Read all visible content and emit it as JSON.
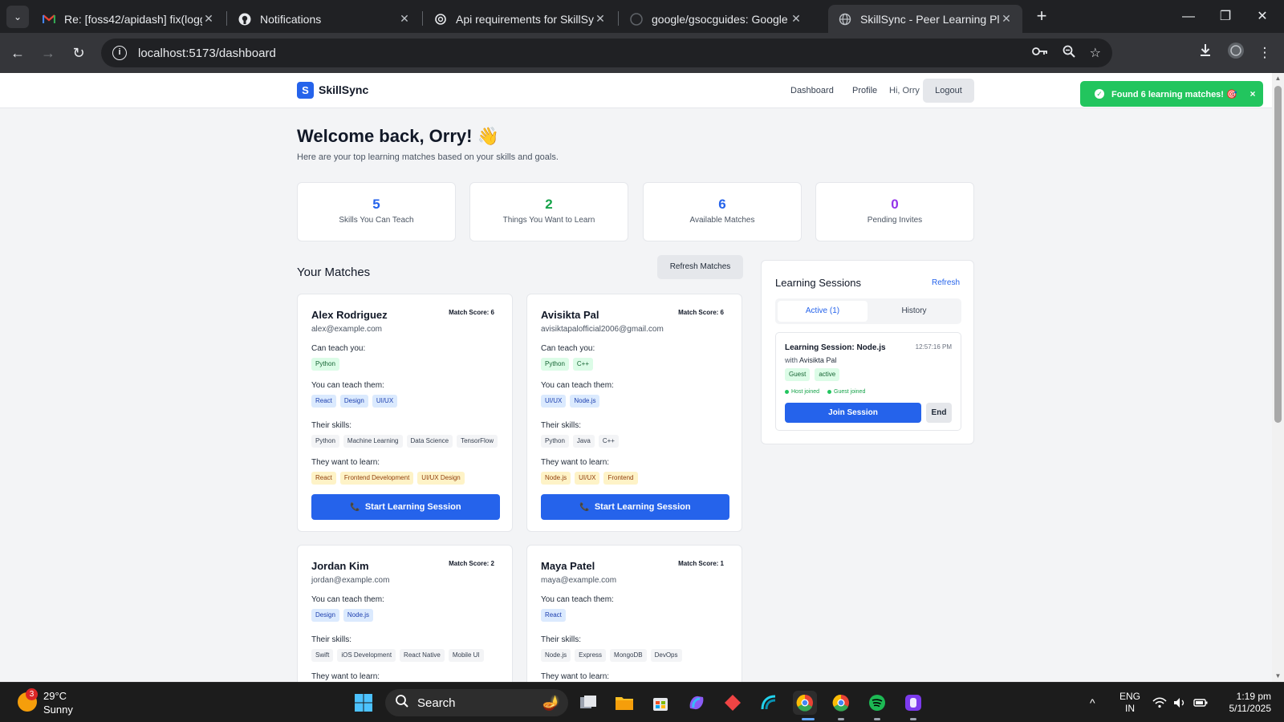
{
  "browser": {
    "tabs": [
      {
        "title": "Re: [foss42/apidash] fix(logging",
        "icon": "gmail-icon"
      },
      {
        "title": "Notifications",
        "icon": "github-icon"
      },
      {
        "title": "Api requirements for SkillSync",
        "icon": "chatgpt-icon"
      },
      {
        "title": "google/gsocguides: Google Sur",
        "icon": "github-icon"
      },
      {
        "title": "SkillSync - Peer Learning Platfor",
        "icon": "globe-icon"
      }
    ],
    "new_tab": "+",
    "url": "localhost:5173/dashboard"
  },
  "app": {
    "logo_letter": "S",
    "name": "SkillSync",
    "nav": {
      "dashboard": "Dashboard",
      "profile": "Profile",
      "greeting": "Hi, Orry",
      "logout": "Logout"
    }
  },
  "toast": {
    "message": "Found 6 learning matches! 🎯",
    "close": "×"
  },
  "welcome": {
    "title": "Welcome back, Orry! 👋",
    "subtitle": "Here are your top learning matches based on your skills and goals."
  },
  "stats": [
    {
      "value": "5",
      "label": "Skills You Can Teach",
      "color": "#2563eb"
    },
    {
      "value": "2",
      "label": "Things You Want to Learn",
      "color": "#16a34a"
    },
    {
      "value": "6",
      "label": "Available Matches",
      "color": "#2563eb"
    },
    {
      "value": "0",
      "label": "Pending Invites",
      "color": "#9333ea"
    }
  ],
  "matches_section": {
    "title": "Your Matches",
    "refresh_label": "Refresh Matches"
  },
  "labels": {
    "can_teach_you": "Can teach you:",
    "you_can_teach": "You can teach them:",
    "their_skills": "Their skills:",
    "they_want": "They want to learn:",
    "start": "Start Learning Session"
  },
  "matches": [
    {
      "name": "Alex Rodriguez",
      "email": "alex@example.com",
      "score": "Match Score: 6",
      "can_teach_you": [
        "Python"
      ],
      "you_can_teach": [
        "React",
        "Design",
        "UI/UX"
      ],
      "their_skills": [
        "Python",
        "Machine Learning",
        "Data Science",
        "TensorFlow"
      ],
      "they_want": [
        "React",
        "Frontend Development",
        "UI/UX Design"
      ]
    },
    {
      "name": "Avisikta Pal",
      "email": "avisiktapalofficial2006@gmail.com",
      "score": "Match Score: 6",
      "can_teach_you": [
        "Python",
        "C++"
      ],
      "you_can_teach": [
        "UI/UX",
        "Node.js"
      ],
      "their_skills": [
        "Python",
        "Java",
        "C++"
      ],
      "they_want": [
        "Node.js",
        "UI/UX",
        "Frontend"
      ]
    },
    {
      "name": "Jordan Kim",
      "email": "jordan@example.com",
      "score": "Match Score: 2",
      "can_teach_you": [],
      "you_can_teach": [
        "Design",
        "Node.js"
      ],
      "their_skills": [
        "Swift",
        "iOS Development",
        "React Native",
        "Mobile UI"
      ],
      "they_want": []
    },
    {
      "name": "Maya Patel",
      "email": "maya@example.com",
      "score": "Match Score: 1",
      "can_teach_you": [],
      "you_can_teach": [
        "React"
      ],
      "their_skills": [
        "Node.js",
        "Express",
        "MongoDB",
        "DevOps"
      ],
      "they_want": []
    }
  ],
  "sessions": {
    "title": "Learning Sessions",
    "refresh": "Refresh",
    "tab_active": "Active (1)",
    "tab_history": "History",
    "card": {
      "title": "Learning Session: Node.js",
      "time": "12:57:16 PM",
      "with_prefix": "with",
      "with_name": "Avisikta Pal",
      "tags": [
        "Guest",
        "active"
      ],
      "host_status": "Host joined",
      "guest_status": "Guest joined",
      "join": "Join Session",
      "end": "End"
    }
  },
  "taskbar": {
    "weather_badge": "3",
    "temperature": "29°C",
    "condition": "Sunny",
    "search": "Search",
    "lang": "ENG",
    "region": "IN",
    "time": "1:19 pm",
    "date": "5/11/2025"
  }
}
